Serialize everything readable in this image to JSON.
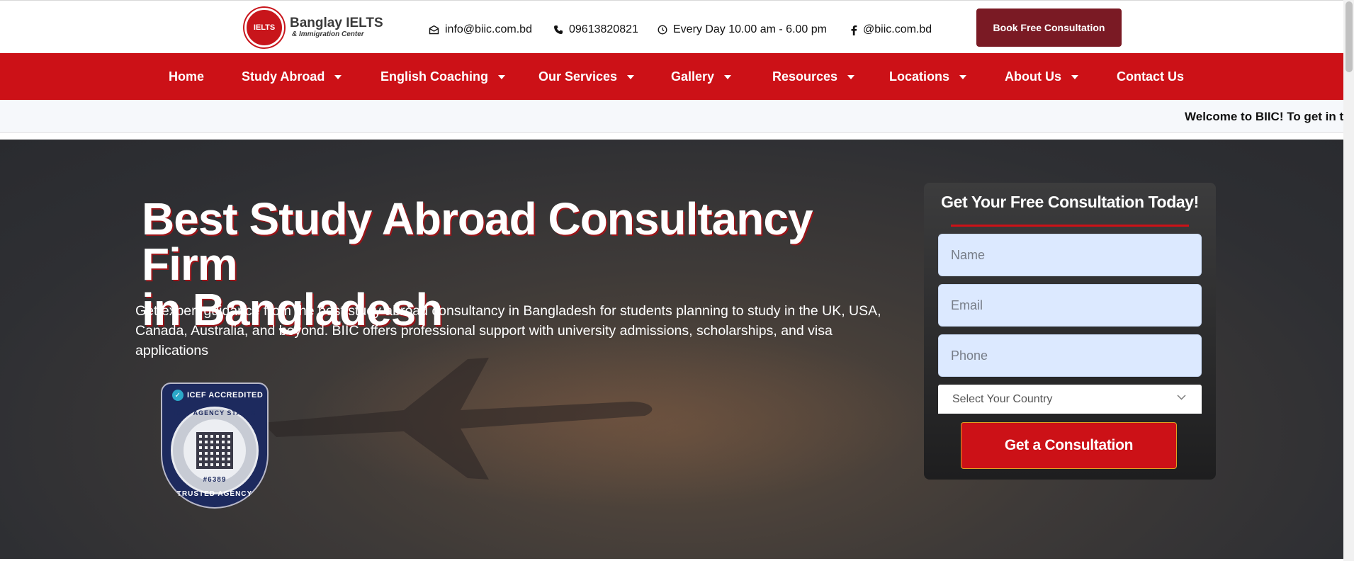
{
  "header": {
    "logo_badge": "IELTS",
    "logo_name": "Banglay IELTS",
    "logo_sub": "& Immigration Center",
    "email": "info@biic.com.bd",
    "phone": "09613820821",
    "hours": "Every Day 10.00 am - 6.00 pm",
    "facebook": "@biic.com.bd",
    "book_button": "Book Free Consultation"
  },
  "nav": {
    "items": [
      {
        "label": "Home",
        "dropdown": false
      },
      {
        "label": "Study Abroad",
        "dropdown": true
      },
      {
        "label": "English Coaching",
        "dropdown": true
      },
      {
        "label": "Our Services",
        "dropdown": true
      },
      {
        "label": "Gallery",
        "dropdown": true
      },
      {
        "label": "Resources",
        "dropdown": true
      },
      {
        "label": "Locations",
        "dropdown": true
      },
      {
        "label": "About Us",
        "dropdown": true
      },
      {
        "label": "Contact Us",
        "dropdown": false
      }
    ]
  },
  "ticker": {
    "text": "Welcome to BIIC! To get in to"
  },
  "hero": {
    "title_line1": "Best Study Abroad Consultancy Firm",
    "title_line2": "in Bangladesh",
    "description": "Get expert guidance from the best study abroad consultancy in Bangladesh for students planning to study in the UK, USA, Canada, Australia, and beyond. BIIC offers professional support with university admissions, scholarships, and visa applications"
  },
  "icef": {
    "top": "ICEF ACCREDITED",
    "status": "ICEF AGENCY STATUS",
    "number": "#6389",
    "bottom": "TRUSTED AGENCY"
  },
  "form": {
    "title": "Get Your Free Consultation Today!",
    "name_placeholder": "Name",
    "email_placeholder": "Email",
    "phone_placeholder": "Phone",
    "country_select": "Select Your Country",
    "submit_label": "Get a Consultation"
  },
  "colors": {
    "nav_red": "#cc1117",
    "book_button": "#7a1a24",
    "input_bg": "#dce9ff"
  }
}
